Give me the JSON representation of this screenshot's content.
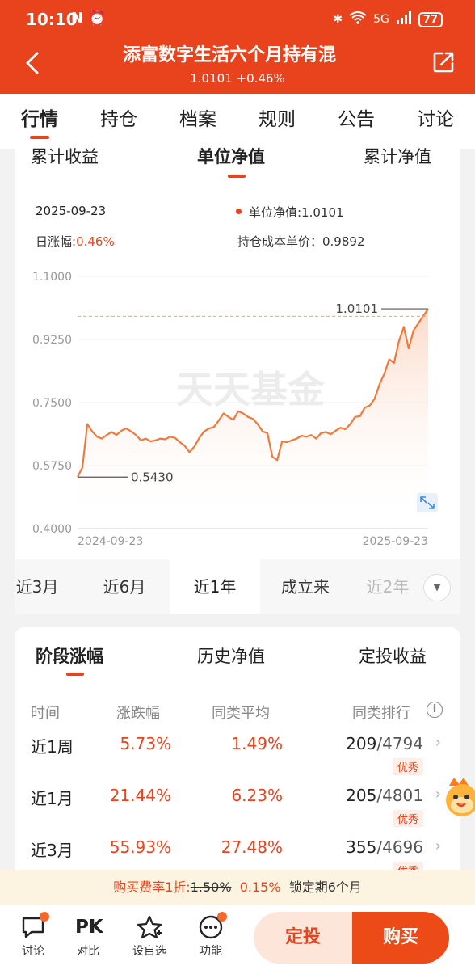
{
  "status_bar": {
    "time": "10:10",
    "left_icons": "N ⏰",
    "network": "5G",
    "battery": "77"
  },
  "header": {
    "title": "添富数字生活六个月持有混",
    "subtitle": "1.0101 +0.46%"
  },
  "tabs": [
    "行情",
    "持仓",
    "档案",
    "规则",
    "公告",
    "讨论"
  ],
  "chart_card": {
    "sub_tabs": [
      "累计收益",
      "单位净值",
      "累计净值"
    ],
    "date": "2025-09-23",
    "nav_label": "单位净值:1.0101",
    "change_label": "日涨幅:",
    "change_value": "0.46%",
    "cost_label": "持仓成本单价：0.9892",
    "periods": [
      "近3月",
      "近6月",
      "近1年",
      "成立来",
      "近2年"
    ]
  },
  "chart_data": {
    "type": "line",
    "title": "",
    "watermark": "天天基金",
    "ylim": [
      0.4,
      1.1
    ],
    "y_ticks": [
      "1.1000",
      "0.9250",
      "0.7500",
      "0.5750",
      "0.4000"
    ],
    "y_tick_values": [
      1.1,
      0.925,
      0.75,
      0.575,
      0.4
    ],
    "x_ticks": [
      "2024-09-23",
      "2025-09-23"
    ],
    "annotations": {
      "start_label": "0.5430",
      "end_label": "1.0101",
      "start_value": 0.543,
      "end_value": 1.0101
    },
    "cost_line": 0.9892,
    "line_color": "#ef7a3d",
    "series": [
      {
        "values": [
          0.543,
          0.57,
          0.69,
          0.67,
          0.655,
          0.65,
          0.66,
          0.668,
          0.66,
          0.672,
          0.678,
          0.67,
          0.66,
          0.645,
          0.65,
          0.642,
          0.645,
          0.65,
          0.648,
          0.655,
          0.652,
          0.64,
          0.63,
          0.612,
          0.628,
          0.652,
          0.67,
          0.678,
          0.682,
          0.7,
          0.72,
          0.71,
          0.702,
          0.726,
          0.72,
          0.71,
          0.705,
          0.69,
          0.67,
          0.665,
          0.6,
          0.59,
          0.642,
          0.64,
          0.645,
          0.65,
          0.658,
          0.655,
          0.66,
          0.65,
          0.665,
          0.668,
          0.662,
          0.672,
          0.68,
          0.676,
          0.69,
          0.71,
          0.712,
          0.736,
          0.742,
          0.76,
          0.8,
          0.83,
          0.87,
          0.86,
          0.92,
          0.96,
          0.9,
          0.95,
          0.97,
          0.99,
          1.0101
        ]
      }
    ]
  },
  "performance": {
    "tabs": [
      "阶段涨幅",
      "历史净值",
      "定投收益"
    ],
    "columns": [
      "时间",
      "涨跌幅",
      "同类平均",
      "同类排行"
    ],
    "rows": [
      {
        "label": "近1周",
        "change": "5.73%",
        "avg": "1.49%",
        "rank": "209",
        "total": "/4794",
        "badge": "优秀"
      },
      {
        "label": "近1月",
        "change": "21.44%",
        "avg": "6.23%",
        "rank": "205",
        "total": "/4801",
        "badge": "优秀"
      },
      {
        "label": "近3月",
        "change": "55.93%",
        "avg": "27.48%",
        "rank": "355",
        "total": "/4696",
        "badge": "优秀"
      }
    ]
  },
  "fee_bar": {
    "prefix": "购买费率1折:",
    "old_rate": "1.50%",
    "new_rate": "0.15%",
    "lock": "锁定期6个月"
  },
  "bottom_bar": {
    "items": [
      "讨论",
      "对比",
      "设自选",
      "功能"
    ],
    "pk_text": "PK",
    "dingtou": "定投",
    "buy": "购买"
  },
  "colors": {
    "brand": "#e8431c",
    "line": "#ef7a3d"
  }
}
